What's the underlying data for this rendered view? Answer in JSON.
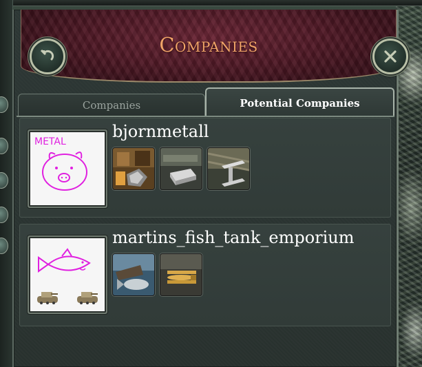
{
  "header": {
    "title": "Companies"
  },
  "tabs": [
    {
      "label": "Companies",
      "active": false
    },
    {
      "label": "Potential Companies",
      "active": true
    }
  ],
  "companies": [
    {
      "name": "bjornmetall",
      "logo_text": "METAL",
      "logo_icon": "pig-drawing-icon",
      "industries": [
        "coal-mine-icon",
        "silver-ingot-icon",
        "steel-beam-icon"
      ]
    },
    {
      "name": "martins_fish_tank_emporium",
      "logo_icon": "fish-and-tanks-drawing-icon",
      "industries": [
        "fishing-icon",
        "biplane-icon"
      ]
    }
  ],
  "colors": {
    "title": "#f0a468",
    "header_bg": "#521a27",
    "logo_ink": "#e020e0",
    "panel_bg": "#2e3836"
  }
}
